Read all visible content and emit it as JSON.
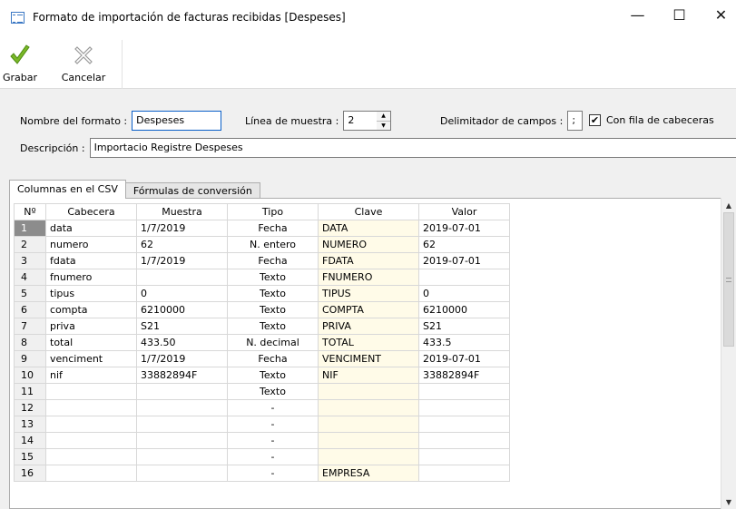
{
  "window": {
    "title": "Formato de importación de facturas recibidas [Despeses]",
    "minimize_glyph": "—",
    "maximize_glyph": "☐",
    "close_glyph": "✕"
  },
  "toolbar": {
    "save_label": "Grabar",
    "save_icon": "checkmark-icon",
    "cancel_label": "Cancelar",
    "cancel_icon": "cross-icon"
  },
  "form": {
    "format_name_label": "Nombre del formato :",
    "format_name_value": "Despeses",
    "sample_line_label": "Línea de muestra :",
    "sample_line_value": "2",
    "delimiter_label": "Delimitador de campos :",
    "delimiter_value": ";",
    "header_row_label": "Con fila de cabeceras",
    "header_row_checked": true,
    "header_row_check_glyph": "✔",
    "description_label": "Descripción :",
    "description_value": "Importacio Registre Despeses"
  },
  "tabs": [
    {
      "label": "Columnas en el CSV",
      "active": true
    },
    {
      "label": "Fórmulas de conversión",
      "active": false
    }
  ],
  "grid": {
    "headers": [
      "Nº",
      "Cabecera",
      "Muestra",
      "Tipo",
      "Clave",
      "Valor"
    ],
    "rows": [
      [
        "1",
        "data",
        "1/7/2019",
        "Fecha",
        "DATA",
        "2019-07-01"
      ],
      [
        "2",
        "numero",
        "62",
        "N. entero",
        "NUMERO",
        "62"
      ],
      [
        "3",
        "fdata",
        "1/7/2019",
        "Fecha",
        "FDATA",
        "2019-07-01"
      ],
      [
        "4",
        "fnumero",
        "",
        "Texto",
        "FNUMERO",
        ""
      ],
      [
        "5",
        "tipus",
        "0",
        "Texto",
        "TIPUS",
        "0"
      ],
      [
        "6",
        "compta",
        "6210000",
        "Texto",
        "COMPTA",
        "6210000"
      ],
      [
        "7",
        "priva",
        "S21",
        "Texto",
        "PRIVA",
        "S21"
      ],
      [
        "8",
        "total",
        "433.50",
        "N. decimal",
        "TOTAL",
        "433.5"
      ],
      [
        "9",
        "venciment",
        "1/7/2019",
        "Fecha",
        "VENCIMENT",
        "2019-07-01"
      ],
      [
        "10",
        "nif",
        "33882894F",
        "Texto",
        "NIF",
        "33882894F"
      ],
      [
        "11",
        "",
        "",
        "Texto",
        "",
        ""
      ],
      [
        "12",
        "",
        "",
        "-",
        "",
        ""
      ],
      [
        "13",
        "",
        "",
        "-",
        "",
        ""
      ],
      [
        "14",
        "",
        "",
        "-",
        "",
        ""
      ],
      [
        "15",
        "",
        "",
        "-",
        "",
        ""
      ],
      [
        "16",
        "",
        "",
        "-",
        "EMPRESA",
        ""
      ]
    ],
    "selected_row": 0
  },
  "scrollbar": {
    "up_glyph": "▲",
    "down_glyph": "▼"
  }
}
